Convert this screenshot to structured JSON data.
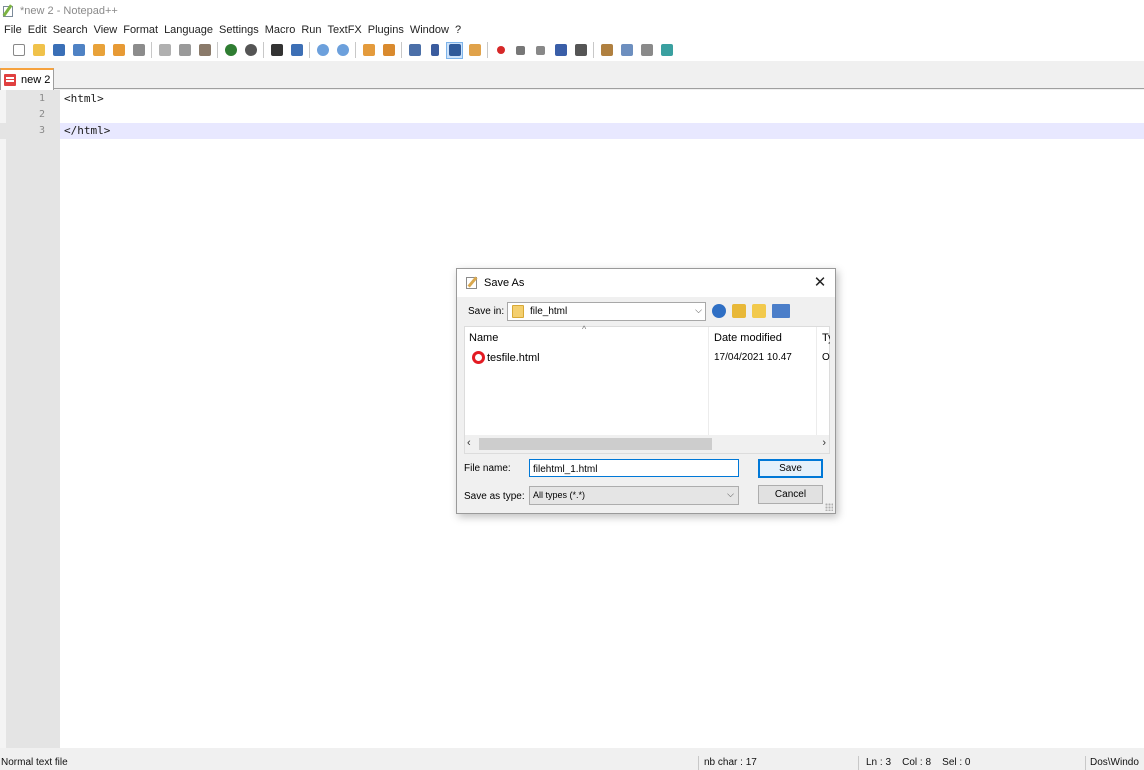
{
  "window": {
    "title": "*new 2 - Notepad++"
  },
  "menu": [
    "File",
    "Edit",
    "Search",
    "View",
    "Format",
    "Language",
    "Settings",
    "Macro",
    "Run",
    "TextFX",
    "Plugins",
    "Window",
    "?"
  ],
  "tabs": [
    {
      "label": "new 2",
      "modified": true
    }
  ],
  "editor": {
    "lines": [
      {
        "num": "1",
        "code": "<html>"
      },
      {
        "num": "2",
        "code": ""
      },
      {
        "num": "3",
        "code": "</html>"
      }
    ],
    "current_line": 3
  },
  "status": {
    "file_type": "Normal text file",
    "nb_char": "nb char : 17",
    "position": "Ln : 3    Col : 8    Sel : 0",
    "eol": "Dos\\Windo"
  },
  "dialog": {
    "title": "Save As",
    "close": "✕",
    "save_in_label": "Save in:",
    "save_in_value": "file_html",
    "columns": {
      "name": "Name",
      "date": "Date modified",
      "type": "Ty"
    },
    "files": [
      {
        "name": "tesfile.html",
        "date": "17/04/2021 10.47",
        "type": "O"
      }
    ],
    "file_name_label": "File name:",
    "file_name_value": "filehtml_1.html",
    "save_type_label": "Save as type:",
    "save_type_value": "All types (*.*)",
    "save_button": "Save",
    "cancel_button": "Cancel"
  },
  "colors": {
    "tab_accent": "#f6a23e",
    "current_line": "#e8e8ff",
    "focus_blue": "#0078d7"
  }
}
